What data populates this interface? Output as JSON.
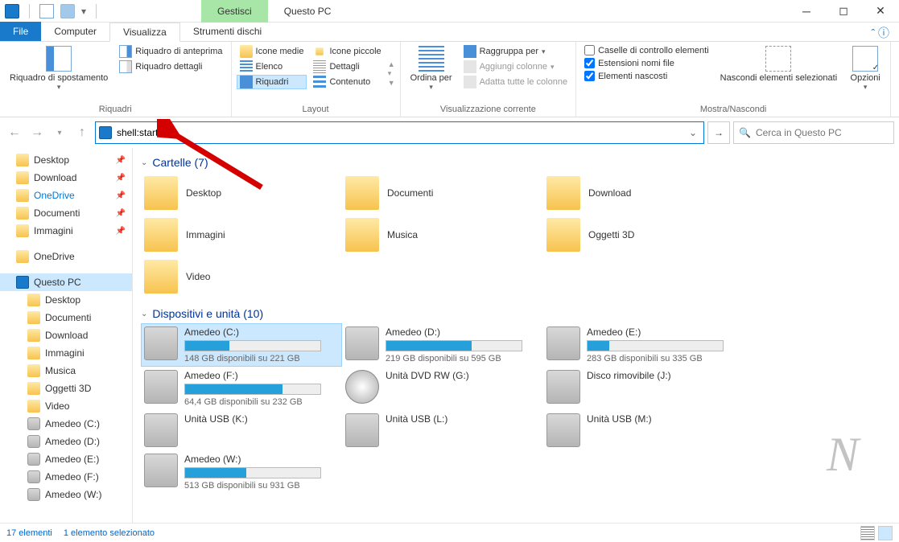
{
  "window": {
    "title": "Questo PC",
    "manage_tab": "Gestisci",
    "tools_tab": "Strumenti dischi"
  },
  "tabs": {
    "file": "File",
    "computer": "Computer",
    "view": "Visualizza"
  },
  "ribbon": {
    "group1": {
      "nav_pane": "Riquadro di spostamento",
      "preview": "Riquadro di anteprima",
      "details": "Riquadro dettagli",
      "label": "Riquadri"
    },
    "group2": {
      "medium": "Icone medie",
      "small": "Icone piccole",
      "list": "Elenco",
      "details": "Dettagli",
      "tiles": "Riquadri",
      "content": "Contenuto",
      "label": "Layout"
    },
    "group3": {
      "sort": "Ordina per",
      "group": "Raggruppa per",
      "addcol": "Aggiungi colonne",
      "fitcol": "Adatta tutte le colonne",
      "label": "Visualizzazione corrente"
    },
    "group4": {
      "checkboxes": "Caselle di controllo elementi",
      "extensions": "Estensioni nomi file",
      "hidden": "Elementi nascosti",
      "hide_sel": "Nascondi elementi selezionati",
      "options": "Opzioni",
      "label": "Mostra/Nascondi"
    }
  },
  "address": {
    "value": "shell:startup"
  },
  "search": {
    "placeholder": "Cerca in Questo PC"
  },
  "sidebar": {
    "quick": [
      {
        "label": "Desktop",
        "pin": true
      },
      {
        "label": "Download",
        "pin": true
      },
      {
        "label": "OneDrive",
        "pin": true,
        "blue": true
      },
      {
        "label": "Documenti",
        "pin": true
      },
      {
        "label": "Immagini",
        "pin": true
      }
    ],
    "onedrive": "OneDrive",
    "thispc": "Questo PC",
    "pc_children": [
      "Desktop",
      "Documenti",
      "Download",
      "Immagini",
      "Musica",
      "Oggetti 3D",
      "Video",
      "Amedeo (C:)",
      "Amedeo (D:)",
      "Amedeo (E:)",
      "Amedeo (F:)",
      "Amedeo (W:)"
    ]
  },
  "content": {
    "folders_header": "Cartelle (7)",
    "folders": [
      "Desktop",
      "Documenti",
      "Download",
      "Immagini",
      "Musica",
      "Oggetti 3D",
      "Video"
    ],
    "drives_header": "Dispositivi e unità (10)",
    "drives": [
      {
        "name": "Amedeo (C:)",
        "sub": "148 GB disponibili su 221 GB",
        "fill": 33,
        "selected": true,
        "type": "hdd"
      },
      {
        "name": "Amedeo (D:)",
        "sub": "219 GB disponibili su 595 GB",
        "fill": 63,
        "type": "hdd"
      },
      {
        "name": "Amedeo (E:)",
        "sub": "283 GB disponibili su 335 GB",
        "fill": 16,
        "type": "hdd"
      },
      {
        "name": "Amedeo (F:)",
        "sub": "64,4 GB disponibili su 232 GB",
        "fill": 72,
        "type": "hdd"
      },
      {
        "name": "Unità DVD RW (G:)",
        "sub": "",
        "fill": 0,
        "type": "dvd"
      },
      {
        "name": "Disco rimovibile (J:)",
        "sub": "",
        "fill": 0,
        "type": "usb"
      },
      {
        "name": "Unità USB (K:)",
        "sub": "",
        "fill": 0,
        "type": "usb"
      },
      {
        "name": "Unità USB (L:)",
        "sub": "",
        "fill": 0,
        "type": "usb"
      },
      {
        "name": "Unità USB (M:)",
        "sub": "",
        "fill": 0,
        "type": "usb"
      },
      {
        "name": "Amedeo (W:)",
        "sub": "513 GB disponibili su 931 GB",
        "fill": 45,
        "type": "hdd"
      }
    ]
  },
  "status": {
    "count": "17 elementi",
    "selected": "1 elemento selezionato"
  }
}
